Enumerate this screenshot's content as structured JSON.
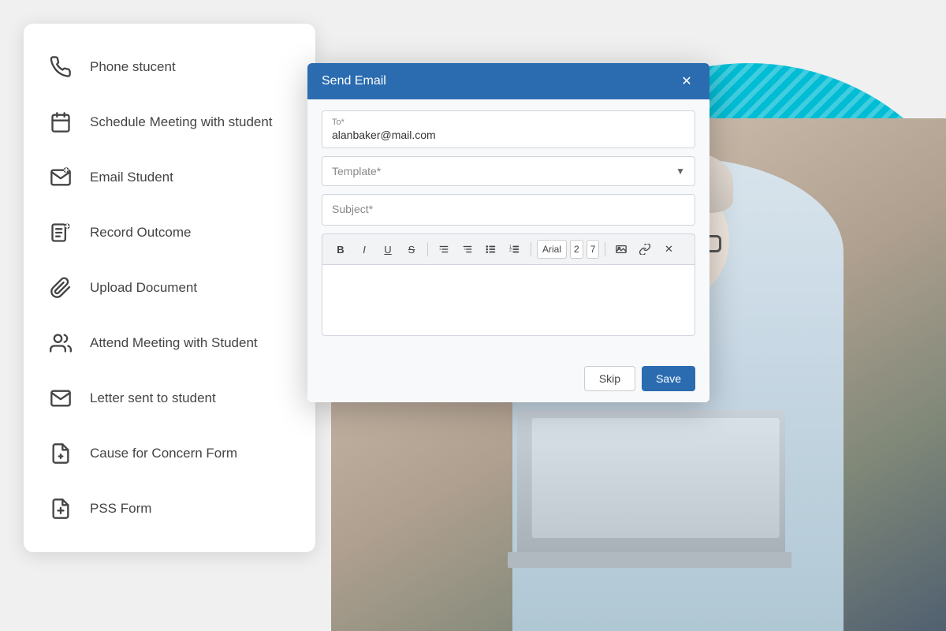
{
  "background": {
    "teal_color": "#00bcd4"
  },
  "action_panel": {
    "items": [
      {
        "id": "phone-student",
        "label": "Phone stucent",
        "icon": "phone"
      },
      {
        "id": "schedule-meeting",
        "label": "Schedule Meeting with student",
        "icon": "calendar"
      },
      {
        "id": "email-student",
        "label": "Email Student",
        "icon": "email-action"
      },
      {
        "id": "record-outcome",
        "label": "Record Outcome",
        "icon": "record"
      },
      {
        "id": "upload-document",
        "label": "Upload Document",
        "icon": "clip"
      },
      {
        "id": "attend-meeting",
        "label": "Attend Meeting with Student",
        "icon": "group"
      },
      {
        "id": "letter-sent",
        "label": "Letter sent to student",
        "icon": "envelope"
      },
      {
        "id": "concern-form",
        "label": "Cause for Concern Form",
        "icon": "form-plus"
      },
      {
        "id": "pss-form",
        "label": "PSS Form",
        "icon": "form-plus2"
      }
    ]
  },
  "email_modal": {
    "title": "Send Email",
    "to_label": "To*",
    "to_value": "alanbaker@mail.com",
    "template_placeholder": "Template*",
    "subject_placeholder": "Subject*",
    "toolbar": {
      "bold": "B",
      "italic": "I",
      "underline": "U",
      "strikethrough": "S",
      "indent_increase": "→",
      "indent_decrease": "←",
      "bullet_list": "•",
      "numbered_list": "1.",
      "font_name": "Arial",
      "font_size": "2",
      "font_size2": "7"
    },
    "skip_label": "Skip",
    "save_label": "Save"
  }
}
